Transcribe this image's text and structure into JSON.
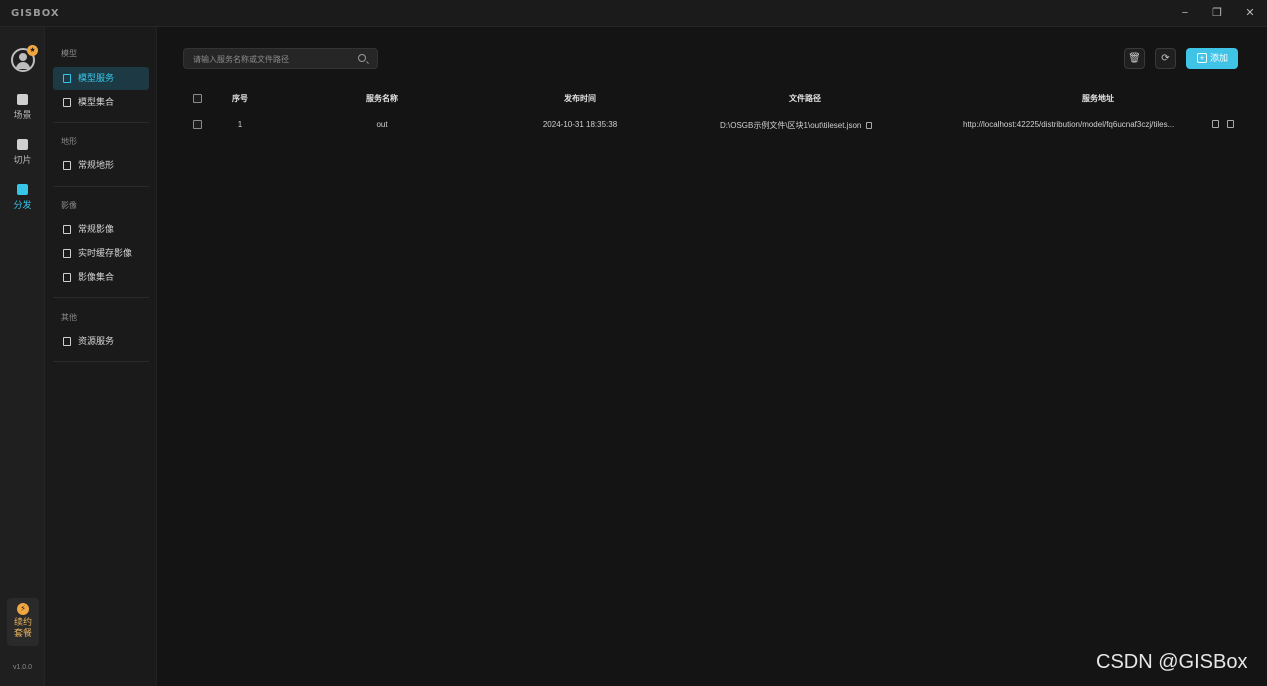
{
  "app": {
    "logo": "GISBOX"
  },
  "window": {
    "min": "−",
    "max": "❐",
    "close": "✕"
  },
  "rail": {
    "badge": "★",
    "items": [
      {
        "label": "场景",
        "icon": "home-icon"
      },
      {
        "label": "切片",
        "icon": "slice-icon"
      },
      {
        "label": "分发",
        "icon": "distribute-icon",
        "active": true
      }
    ],
    "renew": {
      "line1": "续约",
      "line2": "套餐",
      "icon": "lightning-icon",
      "bolt": "⚡"
    },
    "version": "v1.0.0"
  },
  "subnav": {
    "groups": [
      {
        "title": "模型",
        "items": [
          {
            "label": "模型服务",
            "active": true
          },
          {
            "label": "模型集合"
          }
        ]
      },
      {
        "title": "地形",
        "items": [
          {
            "label": "常规地形"
          }
        ]
      },
      {
        "title": "影像",
        "items": [
          {
            "label": "常规影像"
          },
          {
            "label": "实时缓存影像"
          },
          {
            "label": "影像集合"
          }
        ]
      },
      {
        "title": "其他",
        "items": [
          {
            "label": "资源服务"
          }
        ]
      }
    ]
  },
  "toolbar": {
    "search_placeholder": "请输入服务名称或文件路径",
    "delete_icon": "🗑",
    "refresh_icon": "⟳",
    "add_label": "添加"
  },
  "table": {
    "headers": [
      "序号",
      "服务名称",
      "发布时间",
      "文件路径",
      "服务地址"
    ],
    "rows": [
      {
        "index": "1",
        "name": "out",
        "time": "2024-10-31 18:35:38",
        "path": "D:\\OSGB示例文件\\区块1\\out\\tileset.json",
        "url": "http://localhost:42225/distribution/model/fq6ucnaf3czj/tiles..."
      }
    ]
  },
  "watermark": "CSDN @GISBox",
  "colors": {
    "accent": "#36c6e8",
    "add_button": "#3fc3e6",
    "badge": "#f0a742",
    "background": "#141414"
  }
}
